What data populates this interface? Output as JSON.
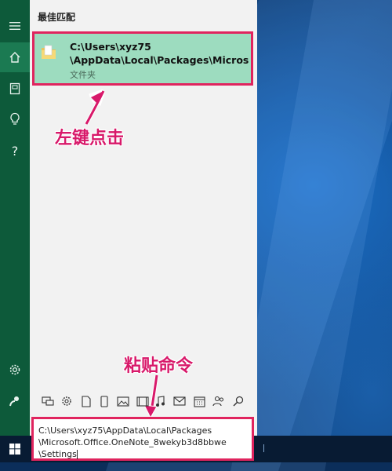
{
  "search": {
    "section_title": "最佳匹配",
    "best_match": {
      "line1": "C:\\Users\\xyz75",
      "line2": "\\AppData\\Local\\Packages\\Microsof",
      "type": "文件夹"
    },
    "query_lines": [
      "C:\\Users\\xyz75\\AppData\\Local\\Packages",
      "\\Microsoft.Office.OneNote_8wekyb3d8bbwe",
      "\\Settings"
    ]
  },
  "annotations": {
    "left_click": "左键点击",
    "paste_command": "粘贴命令"
  },
  "rail_icons": [
    "menu-icon",
    "home-icon",
    "documents-icon",
    "lightbulb-icon",
    "help-icon",
    "settings-icon",
    "feedback-icon"
  ],
  "filter_icons": [
    "apps-icon",
    "settings-icon",
    "document-icon",
    "tablet-icon",
    "photos-icon",
    "video-icon",
    "music-icon",
    "mail-icon",
    "calendar-icon",
    "people-icon",
    "search-icon"
  ],
  "colors": {
    "accent": "#1b7a52",
    "highlight": "#9ddcbf",
    "annotation": "#d8196a"
  }
}
